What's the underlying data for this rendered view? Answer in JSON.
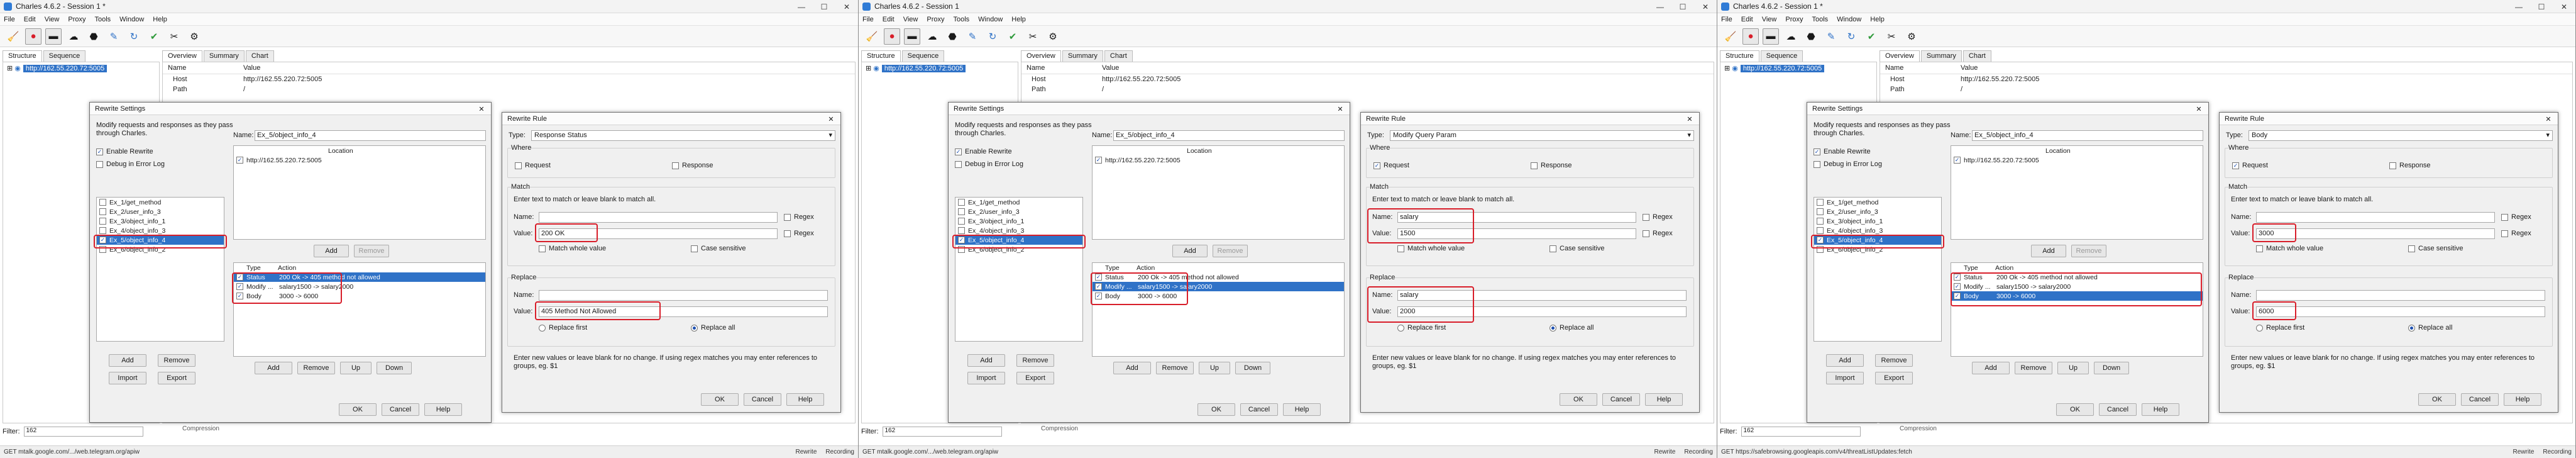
{
  "windows": [
    {
      "app_title": "Charles 4.6.2 - Session 1 *",
      "menu": [
        "File",
        "Edit",
        "View",
        "Proxy",
        "Tools",
        "Window",
        "Help"
      ],
      "tabs": [
        "Structure",
        "Sequence"
      ],
      "overview_tabs": [
        "Overview",
        "Summary",
        "Chart"
      ],
      "host": "http://162.55.220.72:5005",
      "overview_header": {
        "name": "Name",
        "value": "Value"
      },
      "overview_rows": [
        {
          "name": "Host",
          "value": "http://162.55.220.72:5005"
        },
        {
          "name": "Path",
          "value": "/"
        }
      ],
      "filter_label": "Filter:",
      "filter_value": "162",
      "compression": "Compression",
      "status_left": "GET mtalk.google.com/.../web.telegram.org/apiw",
      "status_rewrite": "Rewrite",
      "status_recording": "Recording",
      "rewrite_settings": {
        "title": "Rewrite Settings",
        "description": "Modify requests and responses as they pass through Charles.",
        "enable_rewrite": "Enable Rewrite",
        "debug_error_log": "Debug in Error Log",
        "sets": [
          "Ex_1/get_method",
          "Ex_2/user_info_3",
          "Ex_3/object_info_1",
          "Ex_4/object_info_3",
          "Ex_5/object_info_4",
          "Ex_6/object_info_2"
        ],
        "selected_set": 4,
        "name_label": "Name:",
        "name_value": "Ex_5/object_info_4",
        "location_header": "Location",
        "location_value": "http://162.55.220.72:5005",
        "add": "Add",
        "remove": "Remove",
        "rules_header": {
          "type": "Type",
          "action": "Action"
        },
        "rules": [
          {
            "type": "Status",
            "action": "200 Ok -> 405 method not allowed"
          },
          {
            "type": "Modify ...",
            "action": "salary1500 -> salary2000"
          },
          {
            "type": "Body",
            "action": "3000 -> 6000"
          }
        ],
        "selected_rule": 0,
        "left_buttons": [
          "Add",
          "Remove",
          "Import",
          "Export"
        ],
        "rule_buttons": [
          "Add",
          "Remove",
          "Up",
          "Down"
        ],
        "ok": "OK",
        "cancel": "Cancel",
        "help": "Help"
      },
      "rewrite_rule": {
        "title": "Rewrite Rule",
        "type_label": "Type:",
        "type_value": "Response Status",
        "where_label": "Where",
        "request_label": "Request",
        "response_label": "Response",
        "match_label": "Match",
        "match_hint": "Enter text to match or leave blank to match all.",
        "name_label": "Name:",
        "match_name": "",
        "value_label": "Value:",
        "match_value": "200 OK",
        "regex_label": "Regex",
        "match_whole": "Match whole value",
        "case_sensitive": "Case sensitive",
        "replace_label": "Replace",
        "replace_name": "",
        "replace_value": "405 Method Not Allowed",
        "replace_first": "Replace first",
        "replace_all": "Replace all",
        "replace_hint": "Enter new values or leave blank for no change. If using regex matches you may enter references to groups, eg. $1",
        "ok": "OK",
        "cancel": "Cancel",
        "help": "Help"
      }
    },
    {
      "app_title": "Charles 4.6.2 - Session 1",
      "menu": [
        "File",
        "Edit",
        "View",
        "Proxy",
        "Tools",
        "Window",
        "Help"
      ],
      "tabs": [
        "Structure",
        "Sequence"
      ],
      "overview_tabs": [
        "Overview",
        "Summary",
        "Chart"
      ],
      "host": "http://162.55.220.72:5005",
      "overview_header": {
        "name": "Name",
        "value": "Value"
      },
      "overview_rows": [
        {
          "name": "Host",
          "value": "http://162.55.220.72:5005"
        },
        {
          "name": "Path",
          "value": "/"
        }
      ],
      "filter_label": "Filter:",
      "filter_value": "162",
      "compression": "Compression",
      "status_left": "GET mtalk.google.com/.../web.telegram.org/apiw",
      "status_rewrite": "Rewrite",
      "status_recording": "Recording",
      "rewrite_settings": {
        "title": "Rewrite Settings",
        "description": "Modify requests and responses as they pass through Charles.",
        "enable_rewrite": "Enable Rewrite",
        "debug_error_log": "Debug in Error Log",
        "sets": [
          "Ex_1/get_method",
          "Ex_2/user_info_3",
          "Ex_3/object_info_1",
          "Ex_4/object_info_3",
          "Ex_5/object_info_4",
          "Ex_6/object_info_2"
        ],
        "selected_set": 4,
        "name_label": "Name:",
        "name_value": "Ex_5/object_info_4",
        "location_header": "Location",
        "location_value": "http://162.55.220.72:5005",
        "add": "Add",
        "remove": "Remove",
        "rules_header": {
          "type": "Type",
          "action": "Action"
        },
        "rules": [
          {
            "type": "Status",
            "action": "200 Ok -> 405 method not allowed"
          },
          {
            "type": "Modify ...",
            "action": "salary1500 -> salary2000"
          },
          {
            "type": "Body",
            "action": "3000 -> 6000"
          }
        ],
        "selected_rule": 1,
        "left_buttons": [
          "Add",
          "Remove",
          "Import",
          "Export"
        ],
        "rule_buttons": [
          "Add",
          "Remove",
          "Up",
          "Down"
        ],
        "ok": "OK",
        "cancel": "Cancel",
        "help": "Help"
      },
      "rewrite_rule": {
        "title": "Rewrite Rule",
        "type_label": "Type:",
        "type_value": "Modify Query Param",
        "where_label": "Where",
        "request_label": "Request",
        "response_label": "Response",
        "match_label": "Match",
        "match_hint": "Enter text to match or leave blank to match all.",
        "name_label": "Name:",
        "match_name": "salary",
        "value_label": "Value:",
        "match_value": "1500",
        "regex_label": "Regex",
        "match_whole": "Match whole value",
        "case_sensitive": "Case sensitive",
        "replace_label": "Replace",
        "replace_name": "salary",
        "replace_value": "2000",
        "replace_first": "Replace first",
        "replace_all": "Replace all",
        "replace_hint": "Enter new values or leave blank for no change. If using regex matches you may enter references to groups, eg. $1",
        "ok": "OK",
        "cancel": "Cancel",
        "help": "Help"
      }
    },
    {
      "app_title": "Charles 4.6.2 - Session 1 *",
      "menu": [
        "File",
        "Edit",
        "View",
        "Proxy",
        "Tools",
        "Window",
        "Help"
      ],
      "tabs": [
        "Structure",
        "Sequence"
      ],
      "overview_tabs": [
        "Overview",
        "Summary",
        "Chart"
      ],
      "host": "http://162.55.220.72:5005",
      "overview_header": {
        "name": "Name",
        "value": "Value"
      },
      "overview_rows": [
        {
          "name": "Host",
          "value": "http://162.55.220.72:5005"
        },
        {
          "name": "Path",
          "value": "/"
        }
      ],
      "filter_label": "Filter:",
      "filter_value": "162",
      "compression": "Compression",
      "status_left": "GET https://safebrowsing.googleapis.com/v4/threatListUpdates:fetch",
      "status_rewrite": "Rewrite",
      "status_recording": "Recording",
      "rewrite_settings": {
        "title": "Rewrite Settings",
        "description": "Modify requests and responses as they pass through Charles.",
        "enable_rewrite": "Enable Rewrite",
        "debug_error_log": "Debug in Error Log",
        "sets": [
          "Ex_1/get_method",
          "Ex_2/user_info_3",
          "Ex_3/object_info_1",
          "Ex_4/object_info_3",
          "Ex_5/object_info_4",
          "Ex_6/object_info_2"
        ],
        "selected_set": 4,
        "name_label": "Name:",
        "name_value": "Ex_5/object_info_4",
        "location_header": "Location",
        "location_value": "http://162.55.220.72:5005",
        "add": "Add",
        "remove": "Remove",
        "rules_header": {
          "type": "Type",
          "action": "Action"
        },
        "rules": [
          {
            "type": "Status",
            "action": "200 Ok -> 405 method not allowed"
          },
          {
            "type": "Modify ...",
            "action": "salary1500 -> salary2000"
          },
          {
            "type": "Body",
            "action": "3000 -> 6000"
          }
        ],
        "selected_rule": 2,
        "left_buttons": [
          "Add",
          "Remove",
          "Import",
          "Export"
        ],
        "rule_buttons": [
          "Add",
          "Remove",
          "Up",
          "Down"
        ],
        "ok": "OK",
        "cancel": "Cancel",
        "help": "Help"
      },
      "rewrite_rule": {
        "title": "Rewrite Rule",
        "type_label": "Type:",
        "type_value": "Body",
        "where_label": "Where",
        "request_label": "Request",
        "response_label": "Response",
        "match_label": "Match",
        "match_hint": "Enter text to match or leave blank to match all.",
        "name_label": "Name:",
        "match_name": "",
        "value_label": "Value:",
        "match_value": "3000",
        "regex_label": "Regex",
        "match_whole": "Match whole value",
        "case_sensitive": "Case sensitive",
        "replace_label": "Replace",
        "replace_name": "",
        "replace_value": "6000",
        "replace_first": "Replace first",
        "replace_all": "Replace all",
        "replace_hint": "Enter new values or leave blank for no change. If using regex matches you may enter references to groups, eg. $1",
        "ok": "OK",
        "cancel": "Cancel",
        "help": "Help"
      }
    }
  ],
  "colors": {
    "highlight": "#d81e2a",
    "selection": "#2f72c7"
  }
}
